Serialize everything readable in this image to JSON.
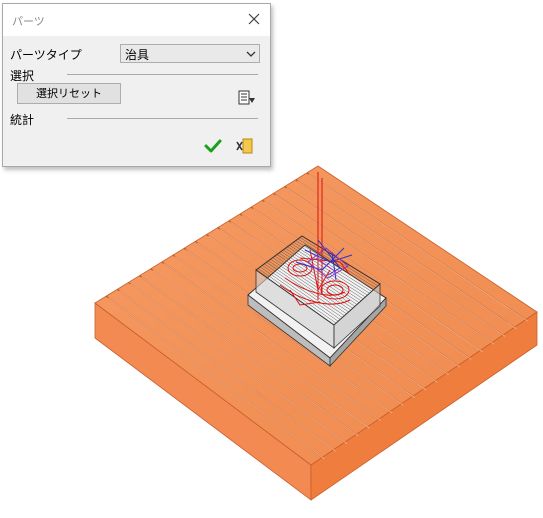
{
  "panel": {
    "title": "パーツ",
    "part_type_label": "パーツタイプ",
    "part_type_value": "治具",
    "selection_section": "選択",
    "reset_button": "選択リセット",
    "stats_section": "統計"
  },
  "colors": {
    "plate": "#f18a50",
    "check": "#1aa11a",
    "panel_bg": "#f0f0f0"
  },
  "icons": [
    "close-icon",
    "chevron-down-icon",
    "list-download-icon",
    "checkmark-icon",
    "exit-icon"
  ]
}
